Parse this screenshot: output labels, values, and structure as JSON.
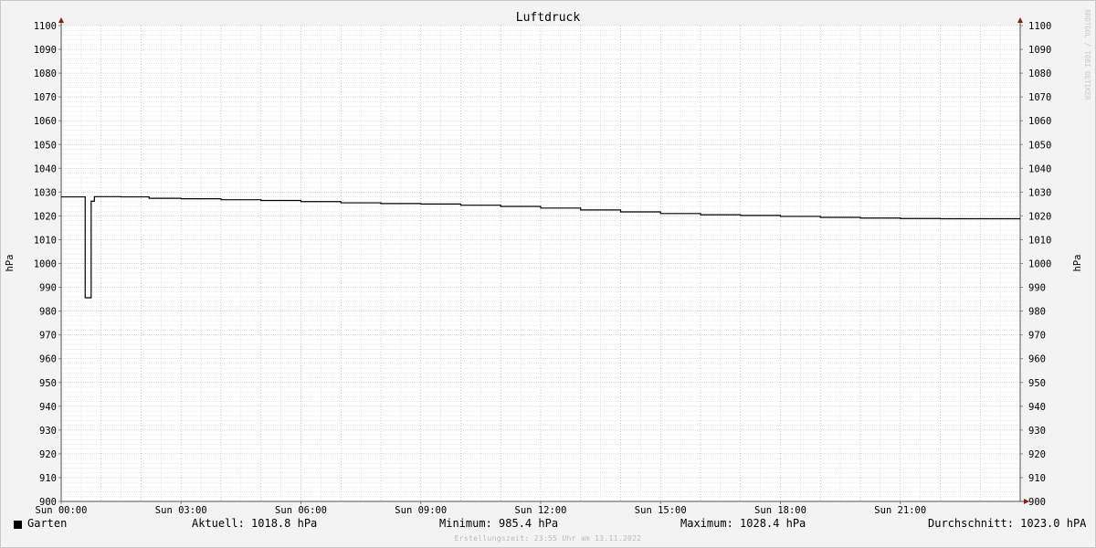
{
  "chart_data": {
    "type": "line",
    "title": "Luftdruck",
    "ylabel": "hPa",
    "ylabel_right": "hPa",
    "ylim": [
      900,
      1100
    ],
    "y_ticks": [
      900,
      910,
      920,
      930,
      940,
      950,
      960,
      970,
      980,
      990,
      1000,
      1010,
      1020,
      1030,
      1040,
      1050,
      1060,
      1070,
      1080,
      1090,
      1100
    ],
    "xlim_hours": [
      0,
      24
    ],
    "x_ticks": [
      {
        "hour": 0,
        "label": "Sun 00:00"
      },
      {
        "hour": 3,
        "label": "Sun 03:00"
      },
      {
        "hour": 6,
        "label": "Sun 06:00"
      },
      {
        "hour": 9,
        "label": "Sun 09:00"
      },
      {
        "hour": 12,
        "label": "Sun 12:00"
      },
      {
        "hour": 15,
        "label": "Sun 15:00"
      },
      {
        "hour": 18,
        "label": "Sun 18:00"
      },
      {
        "hour": 21,
        "label": "Sun 21:00"
      }
    ],
    "grid": true,
    "series": [
      {
        "name": "Garten",
        "color": "#000000",
        "points": [
          [
            0.0,
            1028.0
          ],
          [
            0.58,
            1028.0
          ],
          [
            0.6,
            985.6
          ],
          [
            0.66,
            985.6
          ],
          [
            0.75,
            1026.2
          ],
          [
            0.8,
            1026.2
          ],
          [
            0.83,
            1028.1
          ],
          [
            1.5,
            1028.0
          ],
          [
            2.2,
            1027.4
          ],
          [
            3.0,
            1027.2
          ],
          [
            4.0,
            1026.8
          ],
          [
            5.0,
            1026.5
          ],
          [
            6.0,
            1026.0
          ],
          [
            7.0,
            1025.5
          ],
          [
            8.0,
            1025.2
          ],
          [
            9.0,
            1025.0
          ],
          [
            10.0,
            1024.5
          ],
          [
            11.0,
            1024.0
          ],
          [
            12.0,
            1023.3
          ],
          [
            13.0,
            1022.5
          ],
          [
            14.0,
            1021.7
          ],
          [
            15.0,
            1021.0
          ],
          [
            16.0,
            1020.5
          ],
          [
            17.0,
            1020.2
          ],
          [
            18.0,
            1019.8
          ],
          [
            19.0,
            1019.4
          ],
          [
            20.0,
            1019.1
          ],
          [
            21.0,
            1018.9
          ],
          [
            22.0,
            1018.8
          ],
          [
            23.0,
            1018.8
          ],
          [
            24.0,
            1018.8
          ]
        ]
      }
    ]
  },
  "legend": {
    "series_name": "Garten",
    "current": "Aktuell: 1018.8 hPa",
    "minimum": "Minimum: 985.4 hPa",
    "maximum": "Maximum: 1028.4 hPa",
    "average": "Durchschnitt: 1023.0 hPA"
  },
  "footer": "Erstellungszeit: 23:55 Uhr am 13.11.2022",
  "watermark": "RRDTOOL / TOBI OETIKER"
}
